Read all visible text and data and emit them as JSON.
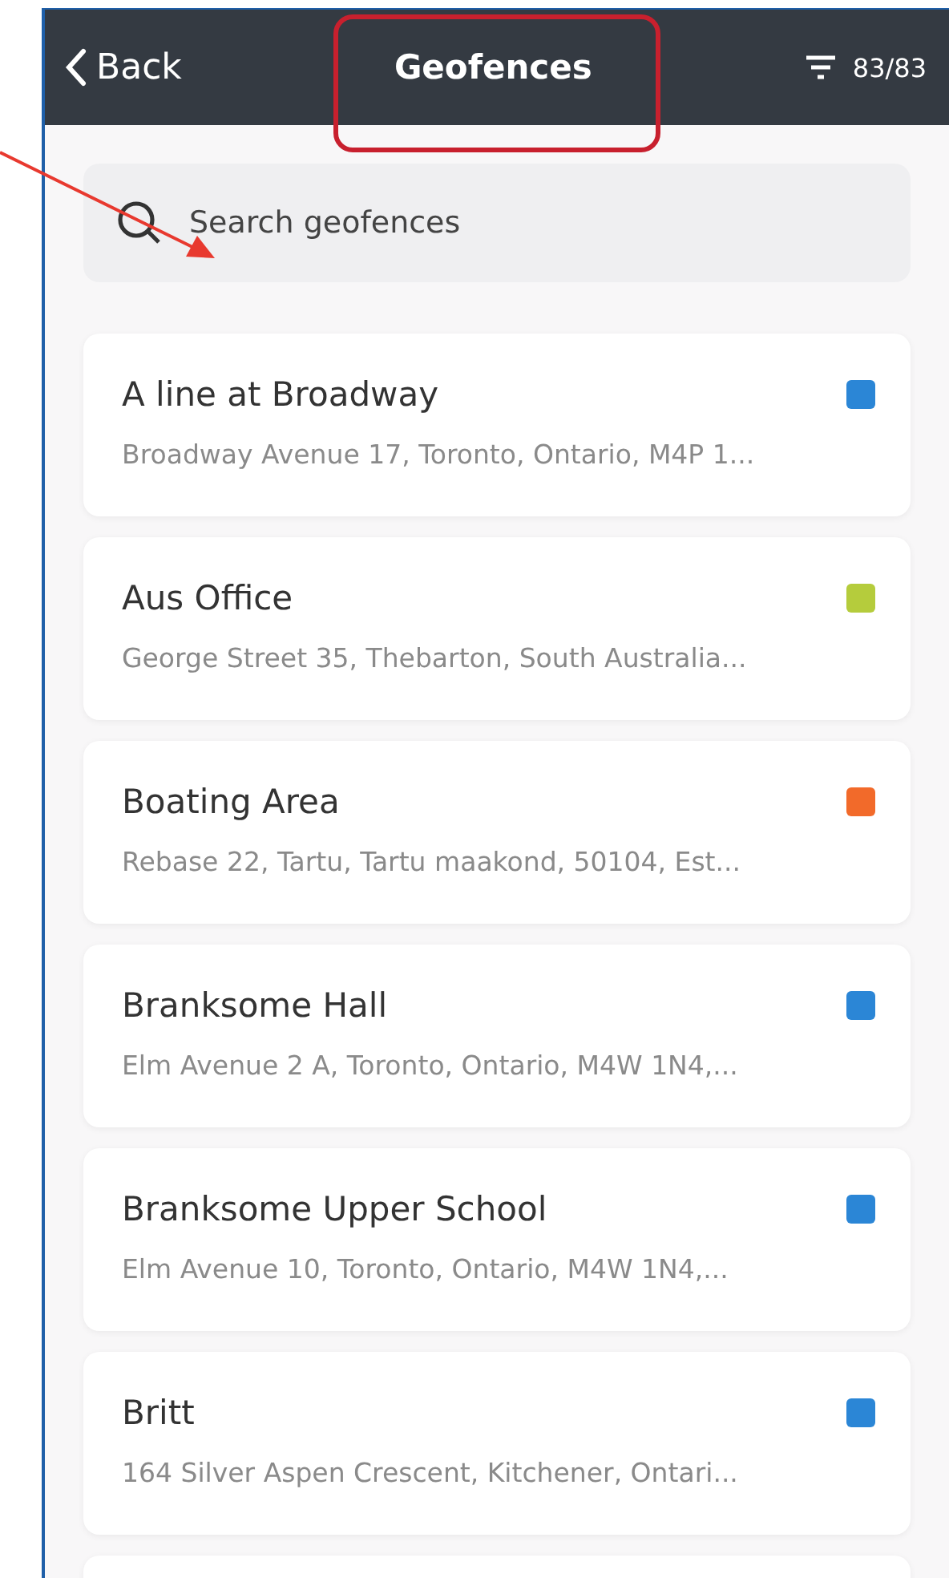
{
  "header": {
    "back": "Back",
    "title": "Geofences",
    "count": "83/83"
  },
  "search": {
    "placeholder": "Search geofences"
  },
  "geofences": [
    {
      "name": "A line at Broadway",
      "address": "Broadway Avenue 17, Toronto, Ontario, M4P 1...",
      "color": "#2b86d6"
    },
    {
      "name": "Aus Office",
      "address": "George Street 35, Thebarton, South Australia...",
      "color": "#b5cc3c"
    },
    {
      "name": "Boating Area",
      "address": "Rebase 22, Tartu, Tartu maakond, 50104, Est...",
      "color": "#f26a2a"
    },
    {
      "name": "Branksome Hall",
      "address": "Elm Avenue 2 A, Toronto, Ontario, M4W 1N4,...",
      "color": "#2b86d6"
    },
    {
      "name": "Branksome Upper School",
      "address": "Elm Avenue 10, Toronto, Ontario, M4W 1N4,...",
      "color": "#2b86d6"
    },
    {
      "name": "Britt",
      "address": "164 Silver Aspen Crescent, Kitchener, Ontari...",
      "color": "#2b86d6"
    }
  ]
}
